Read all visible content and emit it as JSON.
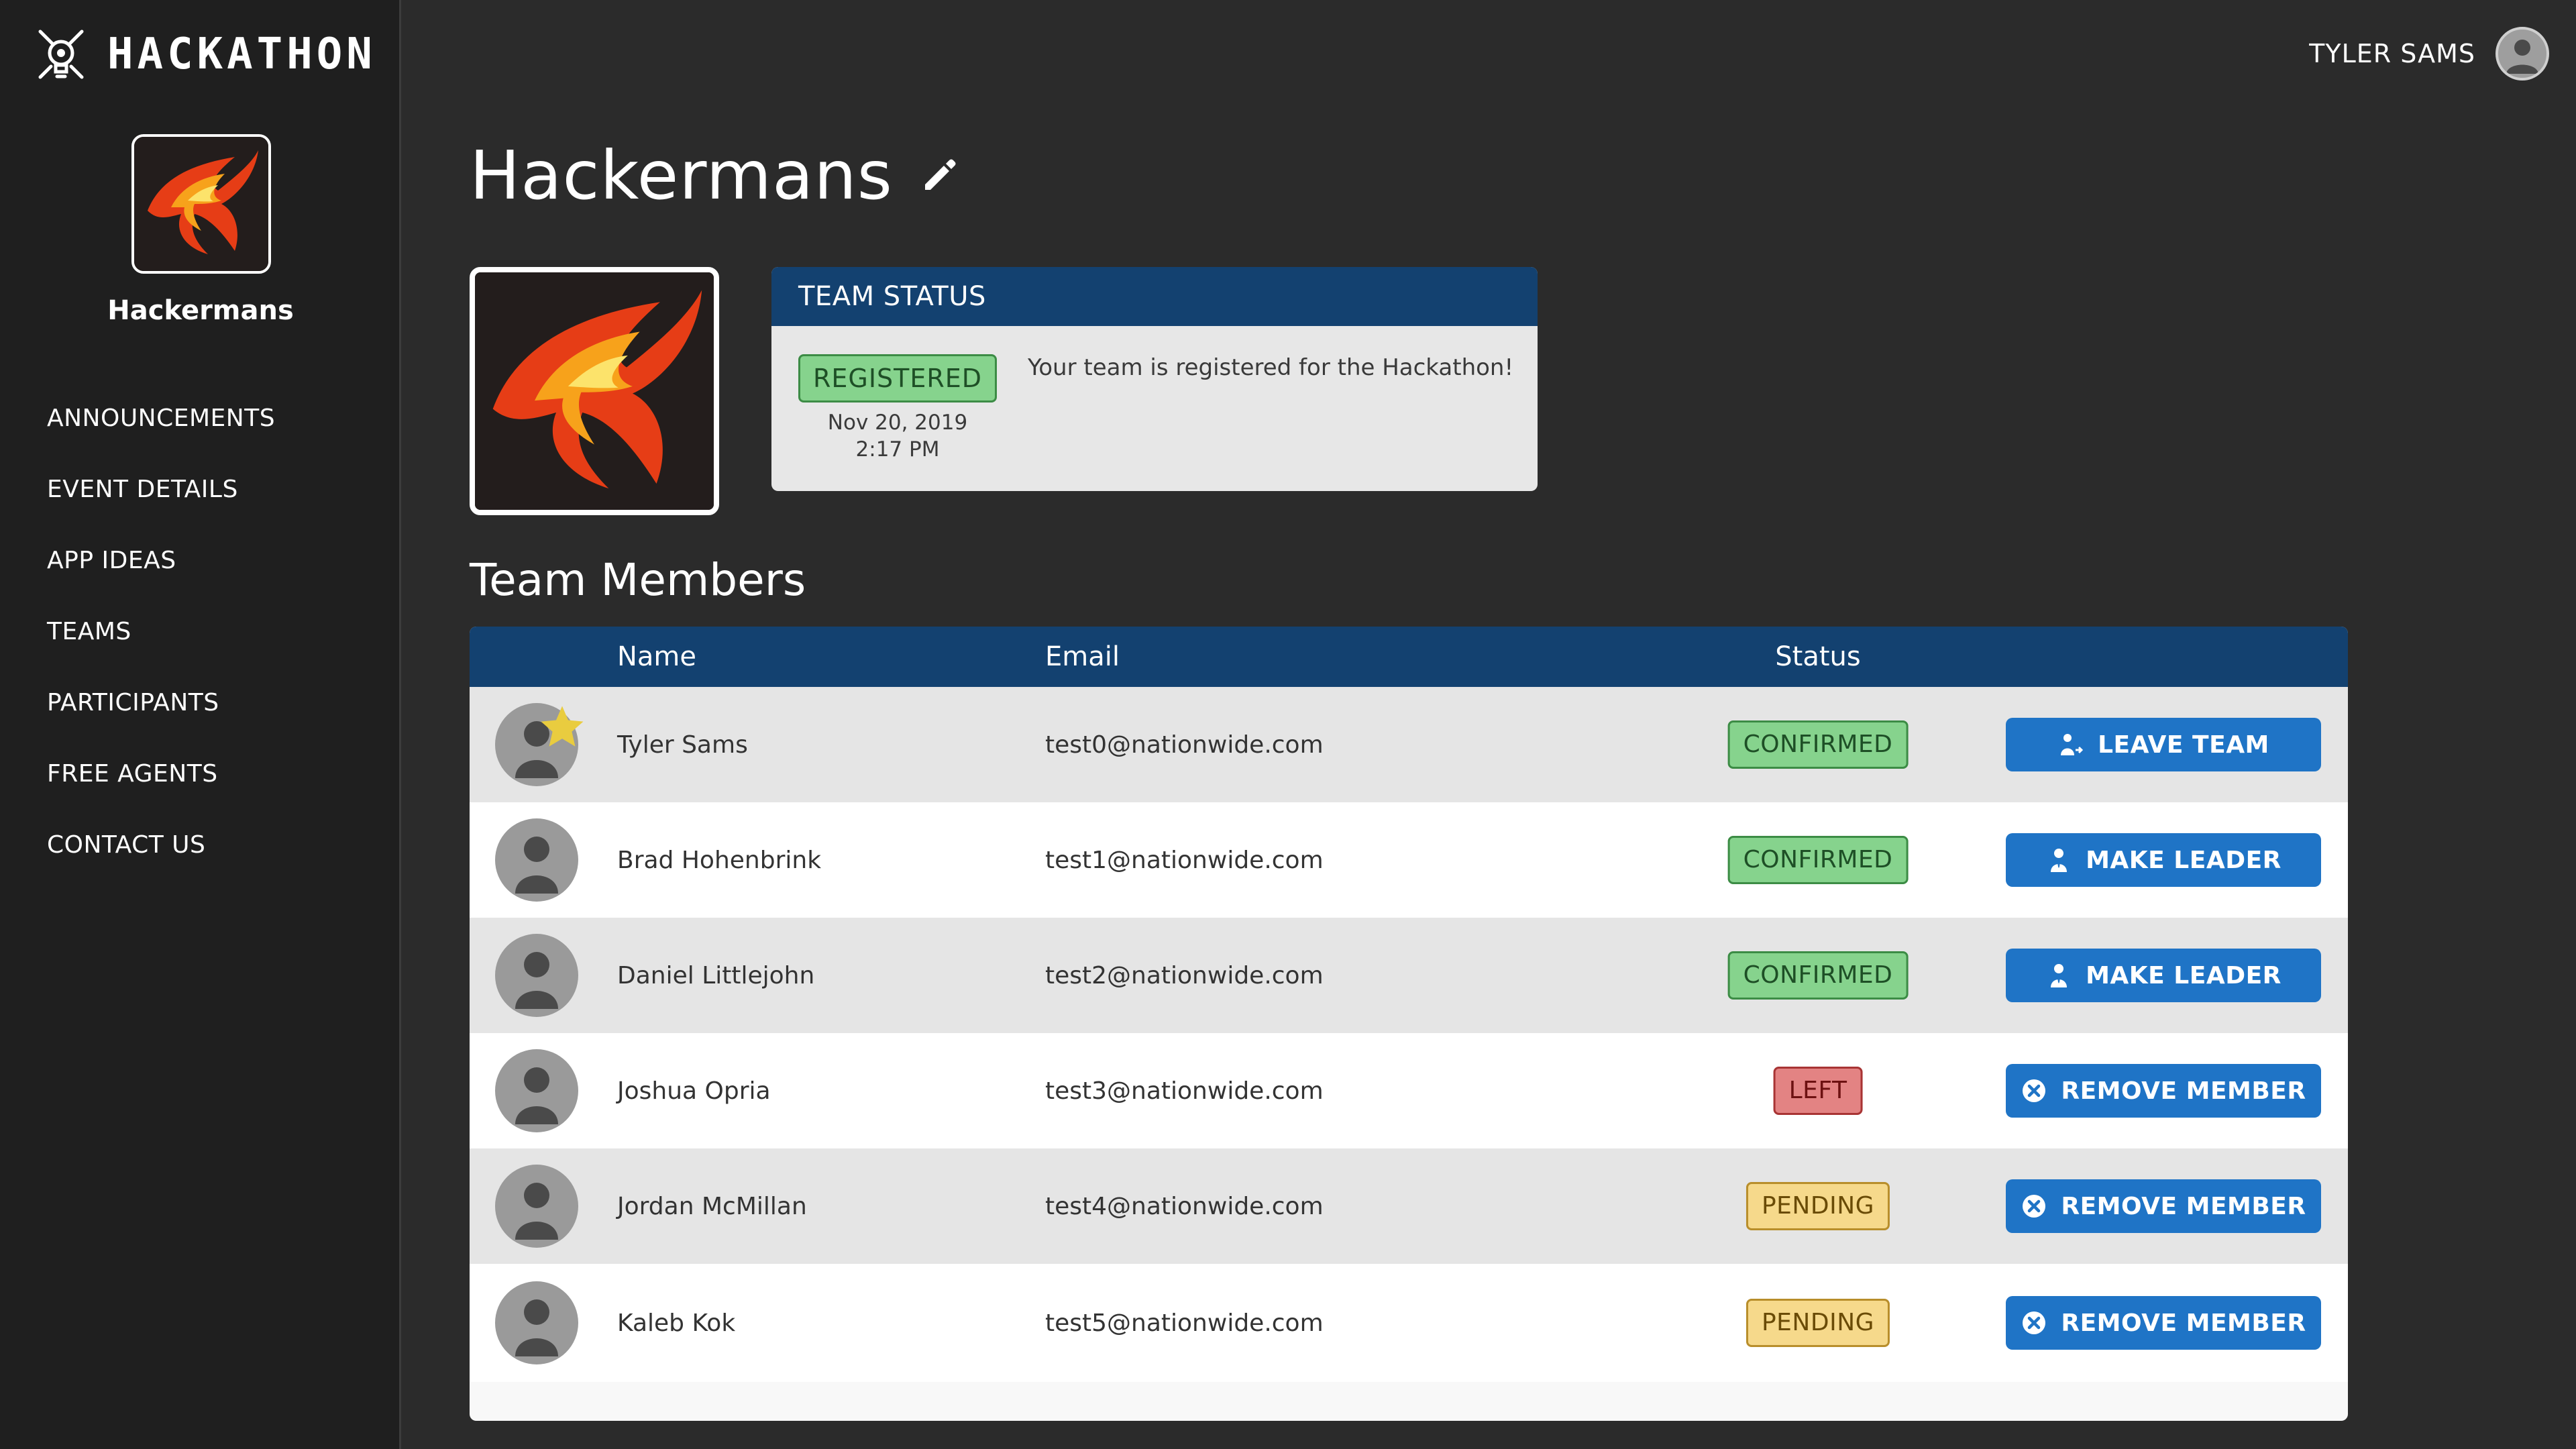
{
  "app": {
    "brand": "HACKATHON"
  },
  "sidebar": {
    "team_name": "Hackermans",
    "nav": [
      "ANNOUNCEMENTS",
      "EVENT DETAILS",
      "APP IDEAS",
      "TEAMS",
      "PARTICIPANTS",
      "FREE AGENTS",
      "CONTACT US"
    ]
  },
  "header": {
    "user_name": "TYLER SAMS"
  },
  "page": {
    "title": "Hackermans"
  },
  "status_card": {
    "heading": "TEAM STATUS",
    "badge": "REGISTERED",
    "date": "Nov 20, 2019",
    "time": "2:17 PM",
    "message": "Your team is registered for the Hackathon!"
  },
  "members": {
    "title": "Team Members",
    "columns": {
      "name": "Name",
      "email": "Email",
      "status": "Status"
    },
    "rows": [
      {
        "name": "Tyler Sams",
        "email": "test0@nationwide.com",
        "status": "CONFIRMED",
        "action": "LEAVE TEAM",
        "leader": true
      },
      {
        "name": "Brad Hohenbrink",
        "email": "test1@nationwide.com",
        "status": "CONFIRMED",
        "action": "MAKE LEADER"
      },
      {
        "name": "Daniel Littlejohn",
        "email": "test2@nationwide.com",
        "status": "CONFIRMED",
        "action": "MAKE LEADER"
      },
      {
        "name": "Joshua Opria",
        "email": "test3@nationwide.com",
        "status": "LEFT",
        "action": "REMOVE MEMBER"
      },
      {
        "name": "Jordan McMillan",
        "email": "test4@nationwide.com",
        "status": "PENDING",
        "action": "REMOVE MEMBER"
      },
      {
        "name": "Kaleb Kok",
        "email": "test5@nationwide.com",
        "status": "PENDING",
        "action": "REMOVE MEMBER"
      }
    ]
  },
  "colors": {
    "header_blue": "#134170",
    "button_blue": "#1f74c6",
    "confirmed_green": "#86d38d",
    "left_red": "#e38383",
    "pending_yellow": "#f6d98b",
    "leader_star": "#e9cc3f"
  }
}
